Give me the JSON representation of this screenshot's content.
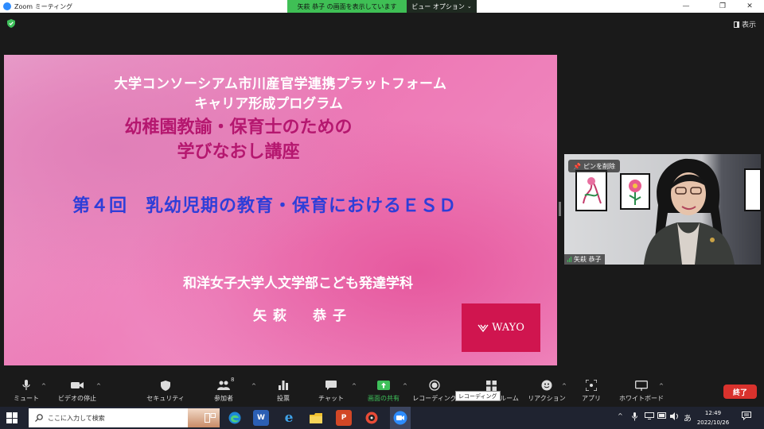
{
  "window": {
    "title": "Zoom ミーティング"
  },
  "banner": {
    "sharing_text": "矢萩 恭子 の画面を表示しています",
    "view_options": "ビュー オプション"
  },
  "top": {
    "display_label": "表示"
  },
  "slide": {
    "line1": "大学コンソーシアム市川産官学連携プラットフォーム",
    "line2": "キャリア形成プログラム",
    "line3": "幼稚園教諭・保育士のための",
    "line4": "学びなおし講座",
    "line5": "第４回　乳幼児期の教育・保育におけるＥＳＤ",
    "line6": "和洋女子大学人文学部こども発達学科",
    "line7": "矢萩　恭子",
    "logo_text": "WAYO"
  },
  "video": {
    "pin_label": "ピンを削除",
    "participant_name": "矢萩 恭子"
  },
  "toolbar": {
    "mute": "ミュート",
    "video_stop": "ビデオの停止",
    "security": "セキュリティ",
    "participants": "参加者",
    "participants_count": "8",
    "polls": "投票",
    "chat": "チャット",
    "share": "画面の共有",
    "recording": "レコーディング",
    "breakout": "トルーム",
    "reactions": "リアクション",
    "apps": "アプリ",
    "whiteboard": "ホワイトボード",
    "end": "終了",
    "tooltip": "レコーディング"
  },
  "taskbar": {
    "search_placeholder": "ここに入力して検索",
    "time": "12:49",
    "date": "2022/10/26",
    "ime": "あ"
  },
  "colors": {
    "share_banner": "#3fbf55",
    "end_button": "#d9322d",
    "slide_blue": "#2e3ed8",
    "slide_magenta": "#b5176f",
    "wayo_red": "#d0154f"
  }
}
